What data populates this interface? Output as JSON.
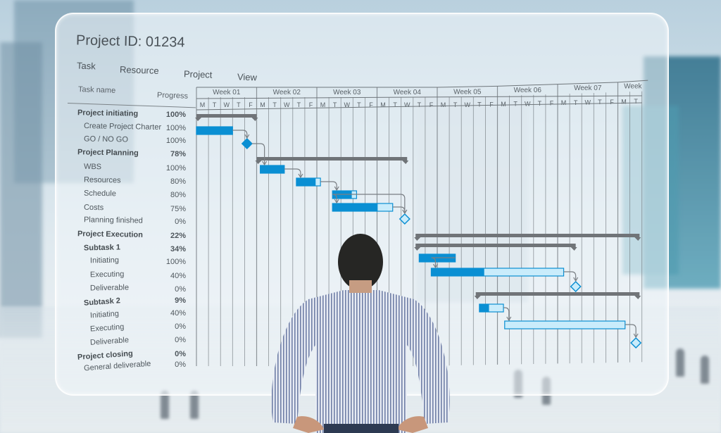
{
  "app": {
    "title": "Project ID: 01234"
  },
  "menu": [
    "Task",
    "Resource",
    "Project",
    "View"
  ],
  "columns": {
    "task_name": "Task name",
    "progress": "Progress"
  },
  "weeks": [
    "Week 01",
    "Week 02",
    "Week 03",
    "Week 04",
    "Week 05",
    "Week 06",
    "Week 07",
    "Week"
  ],
  "days": [
    "M",
    "T",
    "W",
    "T",
    "F"
  ],
  "colors": {
    "bar_done": "#0a8fd3",
    "bar_remaining": "#c9ecfb",
    "summary": "#707478",
    "milestone": "#0a8fd3",
    "grid": "#6f767b"
  },
  "chart_data": {
    "type": "gantt",
    "title": "Project ID: 01234",
    "time_unit": "workday",
    "axis_labels": [
      "Week 01",
      "Week 02",
      "Week 03",
      "Week 04",
      "Week 05",
      "Week 06",
      "Week 07",
      "Week"
    ],
    "tasks": [
      {
        "name": "Project initiating",
        "progress": "100%",
        "level": 0,
        "kind": "summary",
        "start": 0,
        "end": 5
      },
      {
        "name": "Create Project Charter",
        "progress": "100%",
        "level": 1,
        "kind": "task",
        "start": 0,
        "end": 3,
        "done": 1.0
      },
      {
        "name": "GO / NO GO",
        "progress": "100%",
        "level": 1,
        "kind": "milestone",
        "start": 4.2,
        "done": 1.0
      },
      {
        "name": "Project Planning",
        "progress": "78%",
        "level": 0,
        "kind": "summary",
        "start": 5,
        "end": 17.5
      },
      {
        "name": "WBS",
        "progress": "100%",
        "level": 1,
        "kind": "task",
        "start": 5.3,
        "end": 7.3,
        "done": 1.0
      },
      {
        "name": "Resources",
        "progress": "80%",
        "level": 1,
        "kind": "task",
        "start": 8.3,
        "end": 10.3,
        "done": 0.8
      },
      {
        "name": "Schedule",
        "progress": "80%",
        "level": 1,
        "kind": "task",
        "start": 11.3,
        "end": 13.3,
        "done": 0.8
      },
      {
        "name": "Costs",
        "progress": "75%",
        "level": 1,
        "kind": "task",
        "start": 11.3,
        "end": 16.3,
        "done": 0.75
      },
      {
        "name": "Planning finished",
        "progress": "0%",
        "level": 1,
        "kind": "milestone",
        "start": 17.3,
        "done": 0
      },
      {
        "name": "Project Execution",
        "progress": "22%",
        "level": 0,
        "kind": "summary",
        "start": 18.2,
        "end": 36.8
      },
      {
        "name": "Subtask 1",
        "progress": "34%",
        "level": 1,
        "kind": "summary",
        "start": 18.2,
        "end": 31.5
      },
      {
        "name": "Initiating",
        "progress": "100%",
        "level": 2,
        "kind": "task",
        "start": 18.5,
        "end": 21.5,
        "done": 1.0
      },
      {
        "name": "Executing",
        "progress": "40%",
        "level": 2,
        "kind": "task",
        "start": 19.5,
        "end": 30.5,
        "done": 0.4
      },
      {
        "name": "Deliverable",
        "progress": "0%",
        "level": 2,
        "kind": "milestone",
        "start": 31.5,
        "done": 0
      },
      {
        "name": "Subtask 2",
        "progress": "9%",
        "level": 1,
        "kind": "summary",
        "start": 23.2,
        "end": 36.8
      },
      {
        "name": "Initiating",
        "progress": "40%",
        "level": 2,
        "kind": "task",
        "start": 23.5,
        "end": 25.5,
        "done": 0.4
      },
      {
        "name": "Executing",
        "progress": "0%",
        "level": 2,
        "kind": "task",
        "start": 25.6,
        "end": 35.6,
        "done": 0
      },
      {
        "name": "Deliverable",
        "progress": "0%",
        "level": 2,
        "kind": "milestone",
        "start": 36.5,
        "done": 0
      },
      {
        "name": "Project closing",
        "progress": "0%",
        "level": 0,
        "kind": "summary_empty"
      },
      {
        "name": "General deliverable",
        "progress": "0%",
        "level": 1,
        "kind": "none"
      }
    ],
    "dependencies": [
      [
        1,
        2
      ],
      [
        2,
        4
      ],
      [
        4,
        5
      ],
      [
        5,
        6
      ],
      [
        6,
        7
      ],
      [
        6,
        8
      ],
      [
        7,
        8
      ],
      [
        11,
        12
      ],
      [
        12,
        13
      ],
      [
        15,
        16
      ],
      [
        16,
        17
      ]
    ]
  }
}
